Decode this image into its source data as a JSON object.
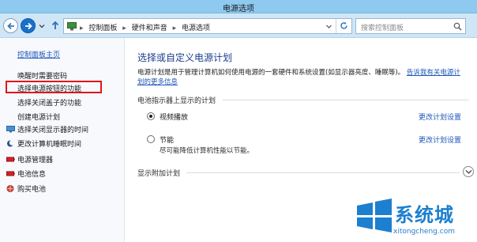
{
  "window": {
    "title": "电源选项"
  },
  "address": {
    "breadcrumbs": [
      "控制面板",
      "硬件和声音",
      "电源选项"
    ],
    "search_placeholder": "搜索控制面板"
  },
  "sidebar": {
    "home": "控制面板主页",
    "items": [
      {
        "label": "唤醒时需要密码",
        "icon": null
      },
      {
        "label": "选择电源按钮的功能",
        "icon": null,
        "highlighted": true
      },
      {
        "label": "选择关闭盖子的功能",
        "icon": null
      },
      {
        "label": "创建电源计划",
        "icon": null
      },
      {
        "label": "选择关闭显示器的时间",
        "icon": "monitor-icon"
      },
      {
        "label": "更改计算机睡眠时间",
        "icon": "moon-icon"
      }
    ],
    "see_also": [
      {
        "label": "电源管理器",
        "icon": "battery-red-icon"
      },
      {
        "label": "电池信息",
        "icon": "battery-red-icon"
      },
      {
        "label": "购买电池",
        "icon": "globe-icon"
      }
    ]
  },
  "main": {
    "heading": "选择或自定义电源计划",
    "description": "电源计划是用于管理计算机如何使用电源的一套硬件和系统设置(如显示器亮度、睡眠等)。",
    "description_link": "告诉我有关电源计划的更多信息",
    "section_plans": "电池指示器上显示的计划",
    "plans": [
      {
        "name": "视频播放",
        "subtitle": "",
        "selected": true,
        "link": "更改计划设置"
      },
      {
        "name": "节能",
        "subtitle": "尽可能降低计算机性能以节能。",
        "selected": false,
        "link": "更改计划设置"
      }
    ],
    "section_more": "显示附加计划"
  },
  "watermark": {
    "brand": "系统城",
    "url": "xitongcheng.com"
  },
  "colors": {
    "accent": "#1f57b8",
    "highlight_box": "#e0161c",
    "titlebar": "#8ec9f0"
  }
}
